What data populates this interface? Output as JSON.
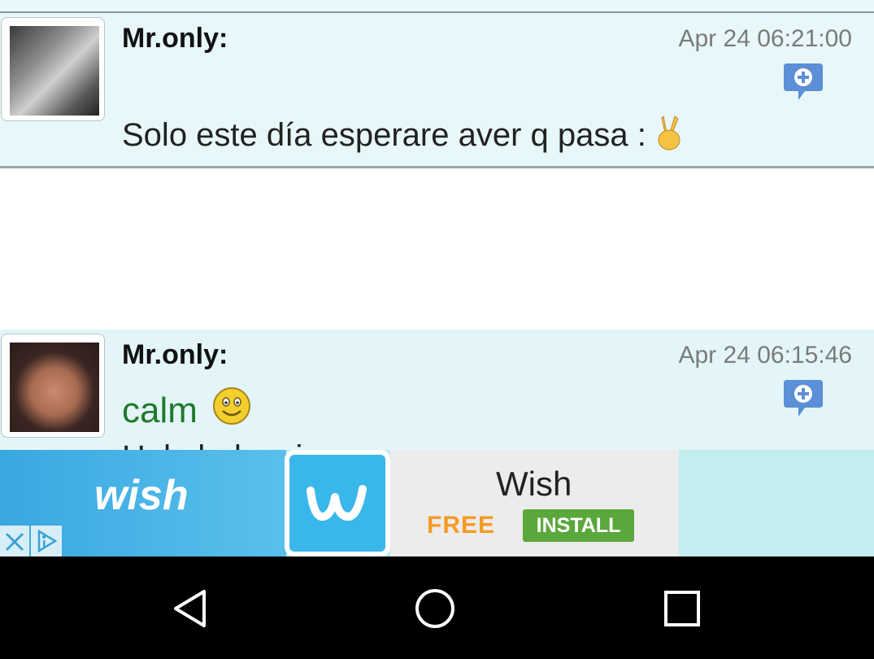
{
  "posts": [
    {
      "author": "Mr.only:",
      "time": "Apr 24 06:21:00",
      "message": "Solo este día esperare aver q pasa :"
    },
    {
      "author": "Mr.only:",
      "time": "Apr 24 06:15:46",
      "message": "calm",
      "partial_text": "Hola buhay i"
    }
  ],
  "ad": {
    "brand_word": "wish",
    "title": "Wish",
    "price": "FREE",
    "cta": "INSTALL"
  },
  "icons": {
    "reply": "add-comment-icon",
    "peace": "victory-hand-emoji",
    "smiley": "smiley-emoji",
    "close": "close-icon",
    "adchoices": "adchoices-icon",
    "back": "back-triangle-icon",
    "home": "home-circle-icon",
    "recents": "recents-square-icon"
  },
  "colors": {
    "post_bg": "#e8f7f9",
    "reply_icon": "#5b8fd6",
    "message_green": "#1f7a2a",
    "timestamp": "#7b7b7b",
    "wish_blue": "#3ab7ea",
    "install_green": "#5aa83c",
    "free_orange": "#f59a22"
  }
}
